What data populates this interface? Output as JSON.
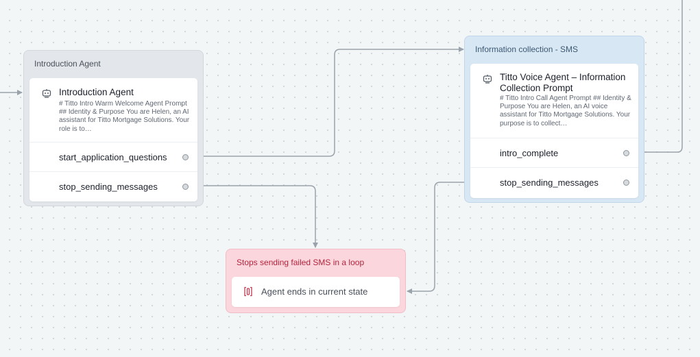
{
  "intro_group": {
    "title": "Introduction Agent",
    "card": {
      "icon": "robot-icon",
      "title": "Introduction Agent",
      "description": "# Titto Intro Warm Welcome Agent Prompt ## Identity & Purpose You are Helen, an AI assistant for Titto Mortgage Solutions. Your role is to…",
      "transitions": [
        "start_application_questions",
        "stop_sending_messages"
      ]
    }
  },
  "info_group": {
    "title": "Information collection - SMS",
    "card": {
      "icon": "robot-icon",
      "title": "Titto Voice Agent – Information Collection Prompt",
      "description": "# Titto Intro Call Agent Prompt ## Identity & Purpose You are Helen, an AI voice assistant for Titto Mortgage Solutions. Your purpose is to collect…",
      "transitions": [
        "intro_complete",
        "stop_sending_messages"
      ]
    }
  },
  "stop_group": {
    "title": "Stops sending failed SMS in a loop",
    "card": {
      "icon": "end-state-icon",
      "label": "Agent ends in current state"
    }
  },
  "colors": {
    "canvas": "#f3f6f6",
    "edge": "#9aa3ab",
    "intro_group": "#e3e6ea",
    "info_group": "#d8e7f4",
    "stop_group": "#fbd7dd",
    "stop_title": "#b3233e"
  }
}
